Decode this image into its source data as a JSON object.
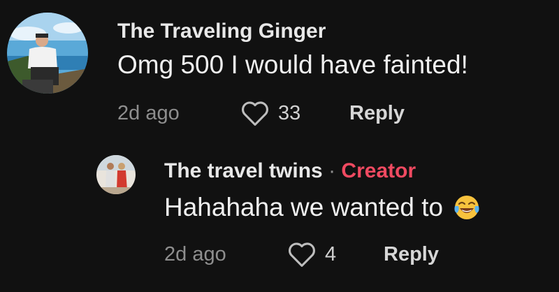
{
  "comments": [
    {
      "author": "The Traveling Ginger",
      "text": "Omg 500 I would have fainted!",
      "time": "2d ago",
      "likes": "33",
      "reply_label": "Reply"
    },
    {
      "author": "The travel twins",
      "separator": "·",
      "badge": "Creator",
      "text": "Hahahaha we wanted to",
      "emoji": "face-with-tears-of-joy",
      "time": "2d ago",
      "likes": "4",
      "reply_label": "Reply"
    }
  ],
  "colors": {
    "background": "#111111",
    "creator_badge": "#f04a61",
    "meta": "#8e8e8e"
  },
  "icons": {
    "like": "heart-outline-icon"
  }
}
